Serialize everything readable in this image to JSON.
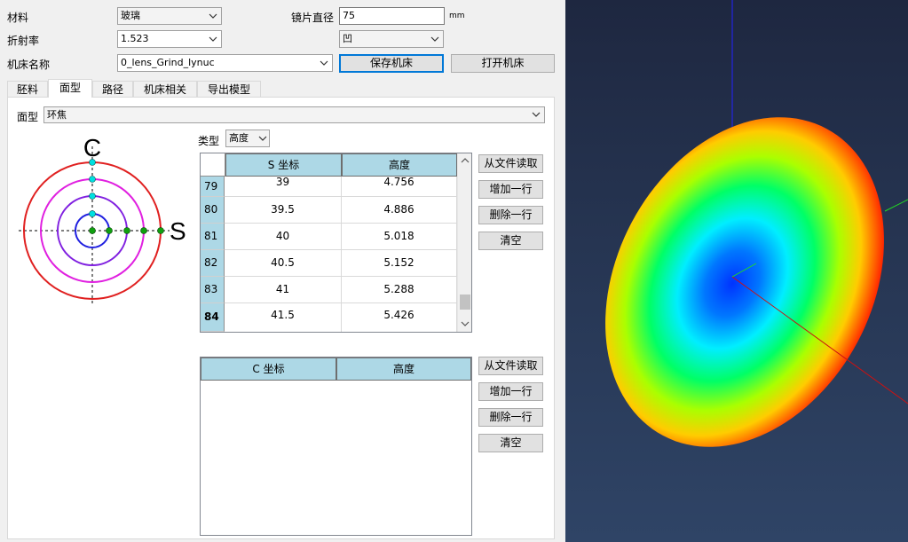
{
  "form": {
    "material_label": "材料",
    "material_value": "玻璃",
    "diameter_label": "镜片直径",
    "diameter_value": "75",
    "diameter_unit": "mm",
    "refractive_label": "折射率",
    "refractive_value": "1.523",
    "shape_value": "凹",
    "machine_label": "机床名称",
    "machine_value": "0_lens_Grind_lynuc",
    "save_machine": "保存机床",
    "open_machine": "打开机床"
  },
  "tabs": [
    {
      "label": "胚料"
    },
    {
      "label": "面型"
    },
    {
      "label": "路径"
    },
    {
      "label": "机床相关"
    },
    {
      "label": "导出模型"
    }
  ],
  "active_tab": 1,
  "surface": {
    "label": "面型",
    "value": "环焦"
  },
  "diagram": {
    "c_label": "C",
    "s_label": "S"
  },
  "type_select": {
    "label": "类型",
    "value": "高度"
  },
  "s_table": {
    "columns": [
      "S 坐标",
      "高度"
    ],
    "rows": [
      {
        "index": "79",
        "s": "39",
        "h": "4.756"
      },
      {
        "index": "80",
        "s": "39.5",
        "h": "4.886"
      },
      {
        "index": "81",
        "s": "40",
        "h": "5.018"
      },
      {
        "index": "82",
        "s": "40.5",
        "h": "5.152"
      },
      {
        "index": "83",
        "s": "41",
        "h": "5.288"
      },
      {
        "index": "84",
        "s": "41.5",
        "h": "5.426"
      }
    ],
    "scroll_position": 0.95
  },
  "c_table": {
    "columns": [
      "C 坐标",
      "高度"
    ],
    "rows": []
  },
  "buttons": {
    "read_file": "从文件读取",
    "add_row": "增加一行",
    "delete_row": "删除一行",
    "clear": "清空"
  },
  "colors": {
    "header_blue": "#add8e6",
    "focus_blue": "#0078d7",
    "viewport_bg": "#263552"
  }
}
